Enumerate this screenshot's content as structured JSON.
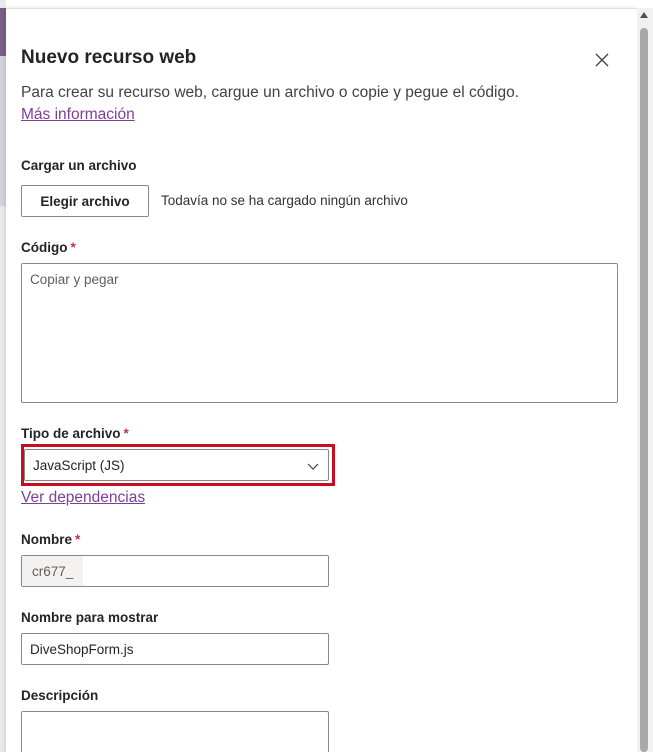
{
  "dialog": {
    "title": "Nuevo recurso web",
    "subtitle": "Para crear su recurso web, cargue un archivo o copie y pegue el código.",
    "more_info": "Más información",
    "close_icon": "close-icon"
  },
  "upload": {
    "label": "Cargar un archivo",
    "button": "Elegir archivo",
    "status": "Todavía no se ha cargado ningún archivo"
  },
  "code": {
    "label": "Código",
    "required": "*",
    "placeholder": "Copiar y pegar",
    "value": ""
  },
  "file_type": {
    "label": "Tipo de archivo",
    "required": "*",
    "selected": "JavaScript (JS)",
    "dependencies_link": "Ver dependencias",
    "highlight_color": "#c50f1f"
  },
  "name": {
    "label": "Nombre",
    "required": "*",
    "prefix": "cr677_",
    "value": ""
  },
  "display_name": {
    "label": "Nombre para mostrar",
    "value": "DiveShopForm.js"
  },
  "description": {
    "label": "Descripción",
    "value": ""
  },
  "colors": {
    "link": "#7d3f98",
    "required": "#c4314b",
    "border": "#8a8886"
  }
}
